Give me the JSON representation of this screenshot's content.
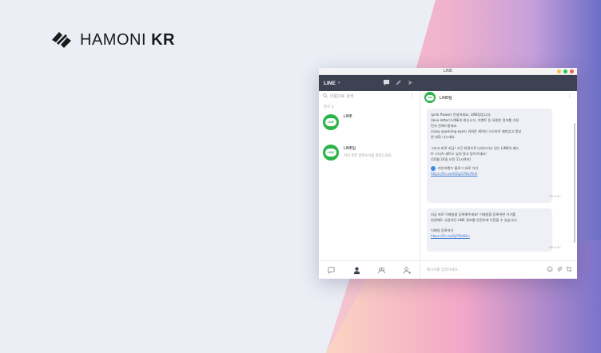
{
  "brand": {
    "logo_text_light": "HAMONI",
    "logo_text_bold": "KR"
  },
  "colors": {
    "line_green": "#2cb34a",
    "navbar": "#3c4251",
    "link": "#3c76d3",
    "close": "#f25c54",
    "minimize": "#f6bf4f",
    "maximize": "#2bc840"
  },
  "window": {
    "title": "LINE"
  },
  "navbar": {
    "brand": "LINE",
    "caret": "▾",
    "icons": [
      "chat-icon",
      "pencil-icon",
      "share-icon"
    ]
  },
  "friends_panel": {
    "search_placeholder": "이름으로 검색",
    "more": "⋮",
    "friend_count_label": "친구 2",
    "friends": [
      {
        "name": "LINE",
        "status": "",
        "avatar_text": "LINE"
      },
      {
        "name": "LINE팀",
        "status": "지인 것은 입력소식을 알리드리요.",
        "avatar_text": "LINE"
      }
    ],
    "bottom_icons": [
      "chats-tab-icon",
      "friends-tab-icon",
      "groups-tab-icon",
      "add-friend-icon"
    ]
  },
  "chat": {
    "name": "LINE팀",
    "avatar_text": "LINE",
    "more": "⋮",
    "message1": {
      "lines": [
        "(pink flower) 안녕하세요, LINE팀입니다.",
        "(love letter) LINE의 최신소식, 이벤트 등 유용한 정보를 가장",
        "먼저 전해드릴게요.",
        "(cony sparkling eyes) 귀여운 캐릭터 스티커로 재미있고 풍성",
        "한 대화 나누세요.",
        "",
        "그리고 바로 지금! 기간 한정으로 나눠드리고 있는 LINE의 베스",
        "트 스티커 세트도 잊지 말고 받아가세요!",
        "(10월 24일 오전 11시까지)"
      ],
      "item_label": "라인프렌즈 블로그 바로 가기",
      "link": "https://lin.ee/OZqrCPbc/fmh",
      "time": "PM 6:20"
    },
    "message2": {
      "lines": [
        "지금 바로 이메일을 등록해주세요! 이메일을 등록하면 기기를",
        "변경해도 사용하던 LINE 정보를 안전하게 이전할 수 있습니다."
      ],
      "item_label": "이메일 등록하기",
      "link": "https://lin.ee/kJYDkWLu",
      "time": "PM 6:20"
    },
    "input_placeholder": "메시지를 입력하세요.",
    "tool_icons": [
      "emoji-icon",
      "attach-icon",
      "crop-icon"
    ]
  }
}
